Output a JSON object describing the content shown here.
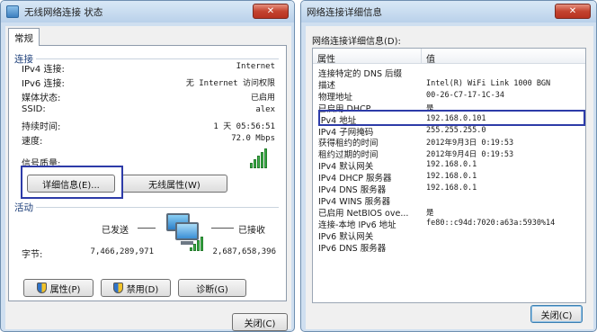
{
  "left_window": {
    "title": "无线网络连接 状态",
    "close_label": "✕",
    "tab": "常规",
    "connection": {
      "section_label": "连接",
      "rows": [
        {
          "label": "IPv4 连接:",
          "value": "Internet"
        },
        {
          "label": "IPv6 连接:",
          "value": "无 Internet 访问权限"
        },
        {
          "label": "媒体状态:",
          "value": "已启用"
        },
        {
          "label": "SSID:",
          "value": "alex"
        },
        {
          "label": "持续时间:",
          "value": "1 天 05:56:51"
        },
        {
          "label": "速度:",
          "value": "72.0 Mbps"
        }
      ],
      "signal_label": "信号质量:",
      "details_button": "详细信息(E)...",
      "wireless_props_button": "无线属性(W)"
    },
    "activity": {
      "section_label": "活动",
      "sent_label": "已发送",
      "received_label": "已接收",
      "bytes_label": "字节:",
      "bytes_sent": "7,466,289,971",
      "bytes_received": "2,687,658,396"
    },
    "buttons": {
      "properties": "属性(P)",
      "disable": "禁用(D)",
      "diagnose": "诊断(G)",
      "close": "关闭(C)"
    }
  },
  "right_window": {
    "title": "网络连接详细信息",
    "close_label": "✕",
    "section_label": "网络连接详细信息(D):",
    "col_property": "属性",
    "col_value": "值",
    "rows": [
      {
        "k": "连接特定的 DNS 后缀",
        "v": ""
      },
      {
        "k": "描述",
        "v": "Intel(R) WiFi Link 1000 BGN"
      },
      {
        "k": "物理地址",
        "v": "00-26-C7-17-1C-34"
      },
      {
        "k": "已启用 DHCP",
        "v": "是"
      },
      {
        "k": "IPv4 地址",
        "v": "192.168.0.101"
      },
      {
        "k": "IPv4 子网掩码",
        "v": "255.255.255.0"
      },
      {
        "k": "获得租约的时间",
        "v": "2012年9月3日 0:19:53"
      },
      {
        "k": "租约过期的时间",
        "v": "2012年9月4日 0:19:53"
      },
      {
        "k": "IPv4 默认网关",
        "v": "192.168.0.1"
      },
      {
        "k": "IPv4 DHCP 服务器",
        "v": "192.168.0.1"
      },
      {
        "k": "IPv4 DNS 服务器",
        "v": "192.168.0.1"
      },
      {
        "k": "IPv4 WINS 服务器",
        "v": ""
      },
      {
        "k": "已启用 NetBIOS ove...",
        "v": "是"
      },
      {
        "k": "连接-本地 IPv6 地址",
        "v": "fe80::c94d:7020:a63a:5930%14"
      },
      {
        "k": "IPv6 默认网关",
        "v": ""
      },
      {
        "k": "IPv6 DNS 服务器",
        "v": ""
      }
    ],
    "close_button": "关闭(C)"
  }
}
